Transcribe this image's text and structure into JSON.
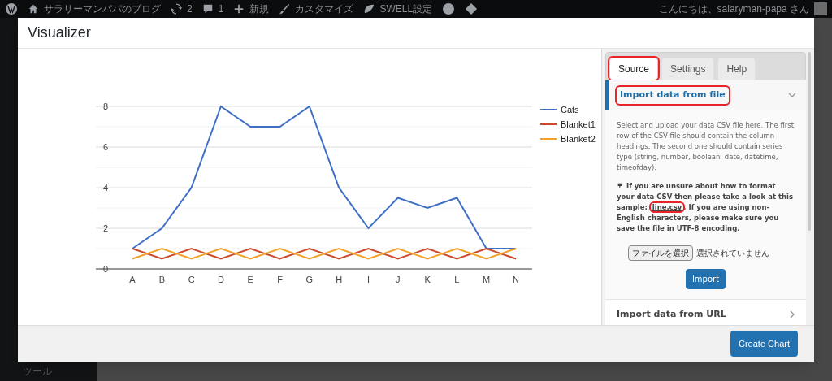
{
  "admin_bar": {
    "site_name": "サラリーマンパパのブログ",
    "updates": "2",
    "comments": "1",
    "new": "新規",
    "customize": "カスタマイズ",
    "swell": "SWELL設定",
    "greeting": "こんにちは、salaryman-papa さん"
  },
  "sidebar": {
    "visible_item": "ツール"
  },
  "modal": {
    "title": "Visualizer",
    "chart": {
      "chart_data": {
        "type": "line",
        "categories": [
          "A",
          "B",
          "C",
          "D",
          "E",
          "F",
          "G",
          "H",
          "I",
          "J",
          "K",
          "L",
          "M",
          "N"
        ],
        "ylim": [
          0,
          8
        ],
        "yticks": [
          0,
          2,
          4,
          6,
          8
        ],
        "grid": true,
        "legend": "right",
        "series": [
          {
            "name": "Cats",
            "color": "#3f6fc4",
            "values": [
              1,
              2,
              4,
              8,
              7,
              7,
              8,
              4,
              2,
              3.5,
              3,
              3.5,
              1,
              1
            ]
          },
          {
            "name": "Blanket1",
            "color": "#cc4a2b",
            "values": [
              1,
              0.5,
              1,
              0.5,
              1,
              0.5,
              1,
              0.5,
              1,
              0.5,
              1,
              0.5,
              1,
              0.5
            ]
          },
          {
            "name": "Blanket2",
            "color": "#f2a12a",
            "values": [
              0.5,
              1,
              0.5,
              1,
              0.5,
              1,
              0.5,
              1,
              0.5,
              1,
              0.5,
              1,
              0.5,
              1
            ]
          }
        ]
      }
    },
    "tabs": [
      {
        "label": "Source",
        "selected": true,
        "highlighted": true
      },
      {
        "label": "Settings",
        "selected": false,
        "highlighted": false
      },
      {
        "label": "Help",
        "selected": false,
        "highlighted": false
      }
    ],
    "sections": [
      {
        "title": "Import data from file",
        "expanded": true,
        "highlighted": true,
        "description": "Select and upload your data CSV file here. The first row of the CSV file should contain the column headings. The second one should contain series type (string, number, boolean, date, datetime, timeofday).",
        "hint_before": "If you are unsure about how to format your data CSV then please take a look at this sample:",
        "hint_link": "line.csv",
        "hint_link_highlighted": true,
        "hint_after": ". If you are using non-English characters, please make sure you save the file in UTF-8 encoding.",
        "file_button": "ファイルを選択",
        "file_status": "選択されていません",
        "import_button": "Import"
      },
      {
        "title": "Import data from URL",
        "expanded": false,
        "highlighted": false
      }
    ],
    "footer_button": "Create Chart"
  }
}
